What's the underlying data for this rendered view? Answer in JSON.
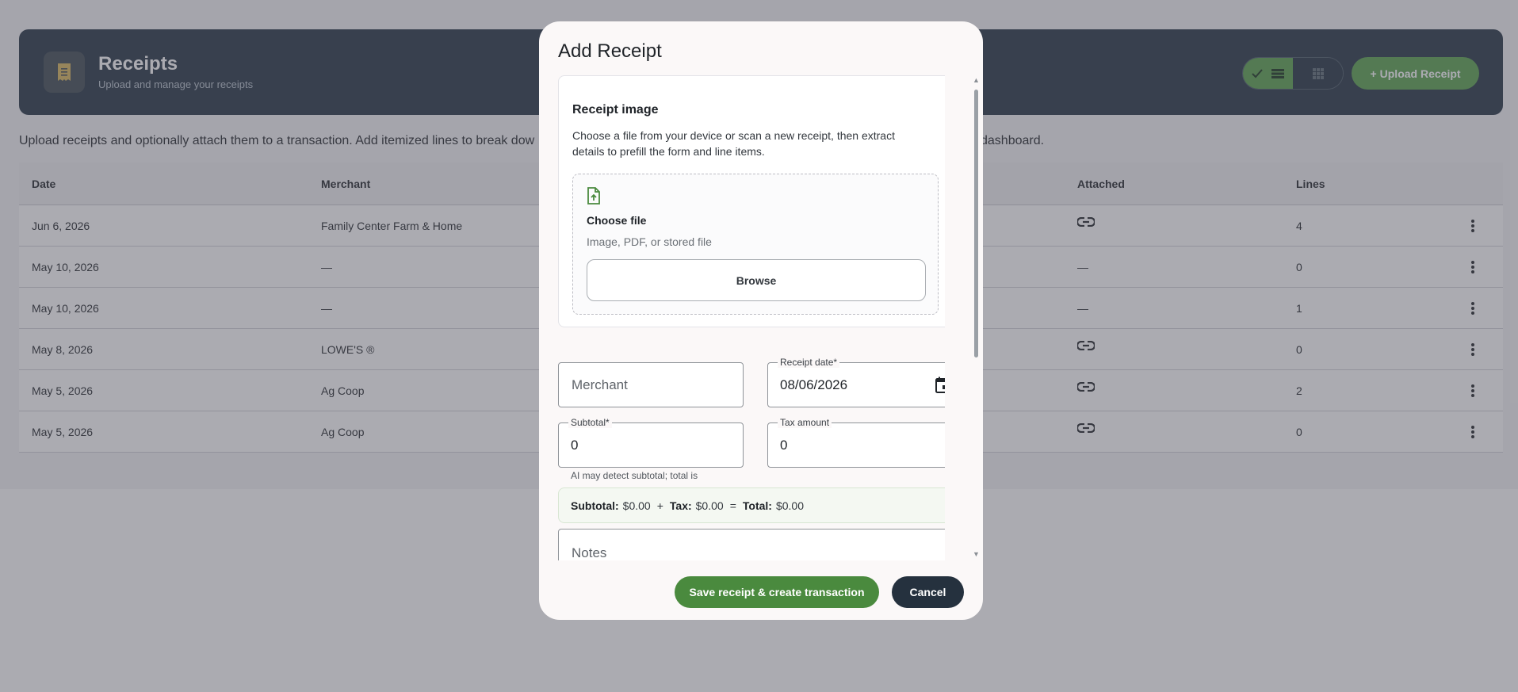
{
  "header": {
    "title": "Receipts",
    "subtitle": "Upload and manage your receipts",
    "icon": "receipt-icon",
    "upload_label": "Upload Receipt"
  },
  "view_toggle": {
    "active": "check-list-icon",
    "inactive": "grid-icon"
  },
  "intro": {
    "text_left": "Upload receipts and optionally attach them to a transaction. Add itemized lines to break dow",
    "text_right": "dashboard."
  },
  "table": {
    "columns": {
      "date": "Date",
      "merchant": "Merchant",
      "attached": "Attached",
      "lines": "Lines"
    },
    "rows": [
      {
        "date": "Jun 6, 2026",
        "merchant": "Family Center Farm & Home",
        "attached": true,
        "lines": "4"
      },
      {
        "date": "May 10, 2026",
        "merchant": "—",
        "attached": false,
        "lines": "0"
      },
      {
        "date": "May 10, 2026",
        "merchant": "—",
        "attached": false,
        "lines": "1"
      },
      {
        "date": "May 8, 2026",
        "merchant": "LOWE'S ®",
        "attached": true,
        "lines": "0"
      },
      {
        "date": "May 5, 2026",
        "merchant": "Ag Coop",
        "attached": true,
        "lines": "2"
      },
      {
        "date": "May 5, 2026",
        "merchant": "Ag Coop",
        "attached": true,
        "lines": "0"
      }
    ],
    "dash": "—"
  },
  "modal": {
    "title": "Add Receipt",
    "receipt_image": {
      "title": "Receipt image",
      "description": "Choose a file from your device or scan a new receipt, then extract details to prefill the form and line items.",
      "choose_title": "Choose file",
      "choose_sub": "Image, PDF, or stored file",
      "browse_label": "Browse"
    },
    "merchant": {
      "placeholder": "Merchant"
    },
    "receipt_date": {
      "label": "Receipt date*",
      "value": "08/06/2026"
    },
    "subtotal": {
      "label": "Subtotal*",
      "value": "0"
    },
    "tax": {
      "label": "Tax amount",
      "value": "0"
    },
    "hint": "AI may detect subtotal; total is",
    "summary": {
      "subtotal_label": "Subtotal:",
      "subtotal_value": "$0.00",
      "plus": "+",
      "tax_label": "Tax:",
      "tax_value": "$0.00",
      "equals": "=",
      "total_label": "Total:",
      "total_value": "$0.00"
    },
    "notes": {
      "placeholder": "Notes"
    },
    "save_label": "Save receipt & create transaction",
    "cancel_label": "Cancel"
  }
}
